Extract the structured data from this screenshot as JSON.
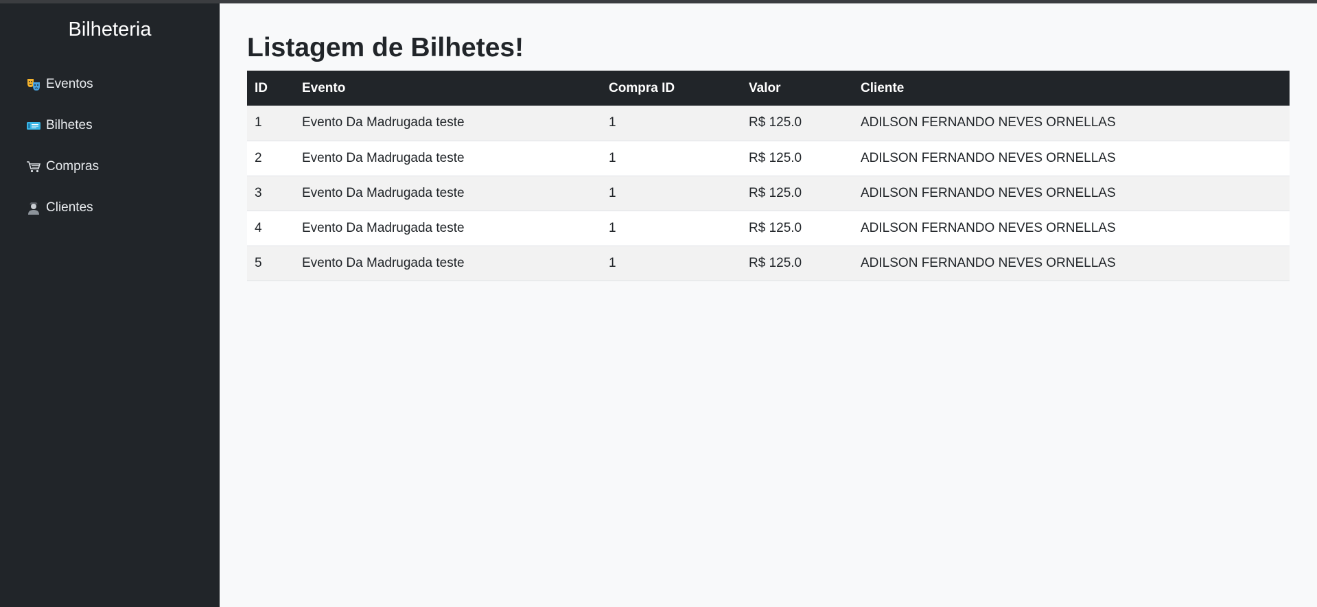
{
  "sidebar": {
    "brand": "Bilheteria",
    "items": [
      {
        "label": "Eventos",
        "icon": "theater-masks-icon"
      },
      {
        "label": "Bilhetes",
        "icon": "ticket-icon"
      },
      {
        "label": "Compras",
        "icon": "shopping-cart-icon"
      },
      {
        "label": "Clientes",
        "icon": "user-icon"
      }
    ]
  },
  "main": {
    "title": "Listagem de Bilhetes!",
    "table": {
      "headers": [
        "ID",
        "Evento",
        "Compra ID",
        "Valor",
        "Cliente"
      ],
      "rows": [
        [
          "1",
          "Evento Da Madrugada teste",
          "1",
          "R$ 125.0",
          "ADILSON FERNANDO NEVES ORNELLAS"
        ],
        [
          "2",
          "Evento Da Madrugada teste",
          "1",
          "R$ 125.0",
          "ADILSON FERNANDO NEVES ORNELLAS"
        ],
        [
          "3",
          "Evento Da Madrugada teste",
          "1",
          "R$ 125.0",
          "ADILSON FERNANDO NEVES ORNELLAS"
        ],
        [
          "4",
          "Evento Da Madrugada teste",
          "1",
          "R$ 125.0",
          "ADILSON FERNANDO NEVES ORNELLAS"
        ],
        [
          "5",
          "Evento Da Madrugada teste",
          "1",
          "R$ 125.0",
          "ADILSON FERNANDO NEVES ORNELLAS"
        ]
      ]
    }
  },
  "colors": {
    "sidebar_bg": "#212529",
    "table_header_bg": "#212529",
    "page_bg": "#f8f9fa",
    "row_striped": "#f2f2f2"
  }
}
